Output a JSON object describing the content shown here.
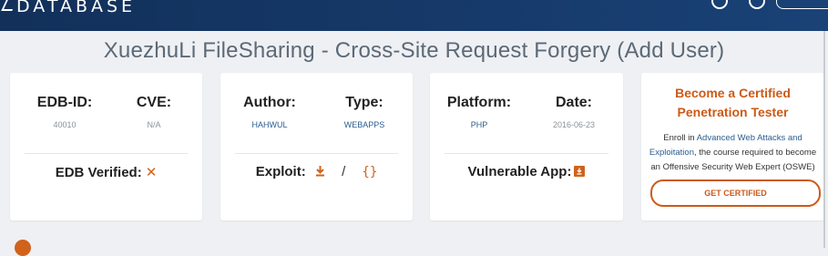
{
  "header": {
    "logo_text": "DATABASE",
    "icons": [
      "user-icon",
      "search-icon"
    ],
    "colors": {
      "bar": "#163a6b",
      "accent": "#d0621b"
    }
  },
  "page_title": "XuezhuLi FileSharing - Cross-Site Request Forgery (Add User)",
  "cards": {
    "edb": {
      "edb_id_label": "EDB-ID:",
      "edb_id_value": "40010",
      "cve_label": "CVE:",
      "cve_value": "N/A",
      "verified_label": "EDB Verified:",
      "verified_icon": "cross-icon"
    },
    "author": {
      "author_label": "Author:",
      "author_value": "HAHWUL",
      "type_label": "Type:",
      "type_value": "WEBAPPS",
      "exploit_label": "Exploit:",
      "separator": "/",
      "view_icon_text": "{}"
    },
    "platform": {
      "platform_label": "Platform:",
      "platform_value": "PHP",
      "date_label": "Date:",
      "date_value": "2016-06-23",
      "vulnerable_app_label": "Vulnerable App:"
    },
    "promo": {
      "title_line1": "Become a Certified",
      "title_line2": "Penetration Tester",
      "text_prefix": "Enroll in",
      "text_link": "Advanced Web Attacks and Exploitation",
      "text_suffix": ", the course required to become an Offensive Security Web Expert (OSWE)",
      "button_label": "GET CERTIFIED"
    }
  }
}
